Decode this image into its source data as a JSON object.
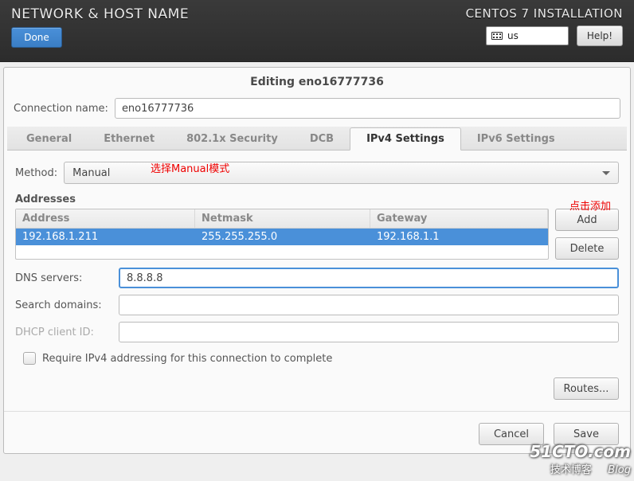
{
  "header": {
    "page_title": "NETWORK & HOST NAME",
    "done_label": "Done",
    "install_title": "CENTOS 7 INSTALLATION",
    "keyboard_layout": "us",
    "help_label": "Help!"
  },
  "dialog": {
    "title": "Editing eno16777736",
    "connection_name_label": "Connection name:",
    "connection_name_value": "eno16777736"
  },
  "tabs": [
    "General",
    "Ethernet",
    "802.1x Security",
    "DCB",
    "IPv4 Settings",
    "IPv6 Settings"
  ],
  "active_tab_index": 4,
  "method": {
    "label": "Method:",
    "value": "Manual",
    "annotation": "选择Manual模式"
  },
  "addresses": {
    "section_label": "Addresses",
    "columns": {
      "address": "Address",
      "netmask": "Netmask",
      "gateway": "Gateway"
    },
    "rows": [
      {
        "address": "192.168.1.211",
        "netmask": "255.255.255.0",
        "gateway": "192.168.1.1"
      }
    ],
    "add_label": "Add",
    "delete_label": "Delete",
    "add_annotation": "点击添加"
  },
  "fields": {
    "dns_label": "DNS servers:",
    "dns_value": "8.8.8.8",
    "search_domains_label": "Search domains:",
    "search_domains_value": "",
    "dhcp_client_id_label": "DHCP client ID:",
    "dhcp_client_id_value": ""
  },
  "require_checkbox": {
    "label": "Require IPv4 addressing for this connection to complete",
    "checked": false
  },
  "routes_label": "Routes...",
  "footer": {
    "cancel_label": "Cancel",
    "save_label": "Save"
  },
  "watermark": {
    "main": "51CTO.com",
    "sub_left": "技术博客",
    "sub_right": "Blog"
  }
}
